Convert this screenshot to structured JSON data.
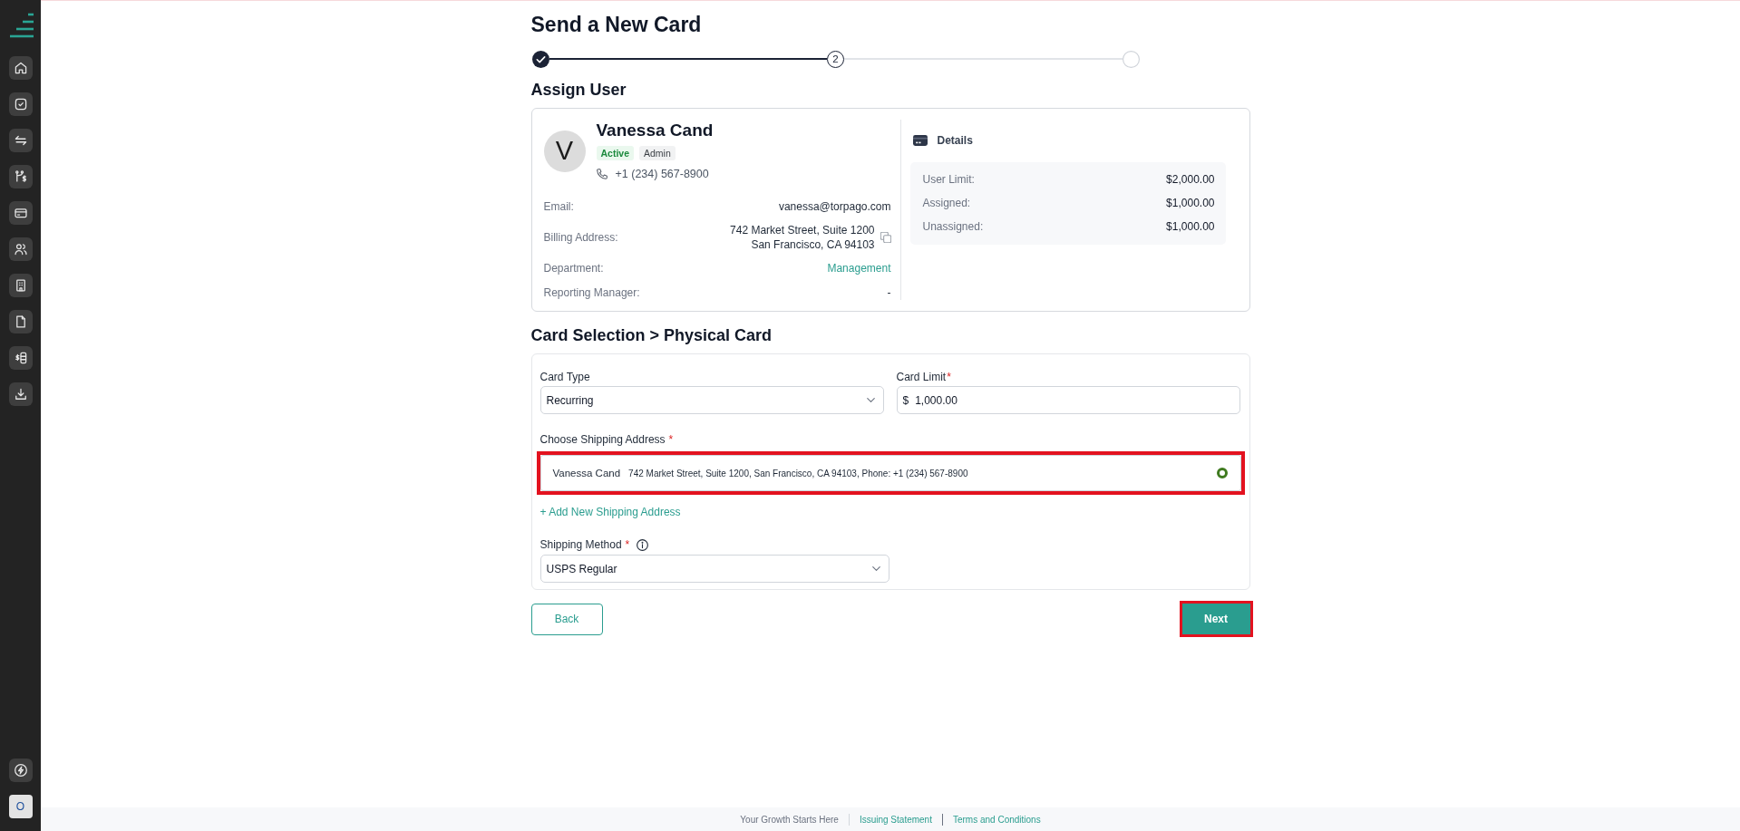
{
  "sidebar": {
    "avatar_initial": "O"
  },
  "page": {
    "title": "Send a New Card"
  },
  "stepper": {
    "steps": [
      {
        "kind": "done"
      },
      {
        "kind": "current",
        "number": "2"
      },
      {
        "kind": "pending"
      }
    ]
  },
  "assign_user": {
    "heading": "Assign User",
    "user": {
      "initial": "V",
      "name": "Vanessa Cand",
      "badges": [
        {
          "label": "Active",
          "kind": "status"
        },
        {
          "label": "Admin",
          "kind": "role"
        }
      ],
      "phone": "+1 (234) 567-8900"
    },
    "fields": [
      {
        "label": "Email:",
        "value": "vanessa@torpago.com",
        "kind": "text"
      },
      {
        "label": "Billing Address:",
        "lines": [
          "742 Market Street, Suite 1200",
          "San Francisco, CA 94103"
        ],
        "kind": "address"
      },
      {
        "label": "Department:",
        "value": "Management",
        "kind": "link"
      },
      {
        "label": "Reporting Manager:",
        "value": "-",
        "kind": "text"
      }
    ],
    "details": {
      "title": "Details",
      "rows": [
        {
          "label": "User Limit:",
          "value": "$2,000.00"
        },
        {
          "label": "Assigned:",
          "value": "$1,000.00"
        },
        {
          "label": "Unassigned:",
          "value": "$1,000.00"
        }
      ]
    }
  },
  "card_selection": {
    "heading": "Card Selection > Physical Card",
    "card_type": {
      "label": "Card Type",
      "value": "Recurring"
    },
    "card_limit": {
      "label": "Card Limit",
      "required_mark": "*",
      "currency": "$",
      "value": "1,000.00"
    },
    "shipping_address": {
      "label": "Choose Shipping Address",
      "required_mark": "*",
      "options": [
        {
          "name": "Vanessa Cand",
          "address": "742 Market Street, Suite 1200, San Francisco, CA 94103, Phone: +1 (234) 567-8900",
          "selected": true,
          "highlighted": true
        }
      ],
      "add_link": "+ Add New Shipping Address"
    },
    "shipping_method": {
      "label": "Shipping Method",
      "required_mark": "*",
      "value": "USPS Regular"
    }
  },
  "actions": {
    "back": "Back",
    "next": {
      "label": "Next",
      "highlighted": true
    }
  },
  "footer": {
    "tagline": "Your Growth Starts Here",
    "links": [
      "Issuing Statement",
      "Terms and Conditions"
    ]
  }
}
